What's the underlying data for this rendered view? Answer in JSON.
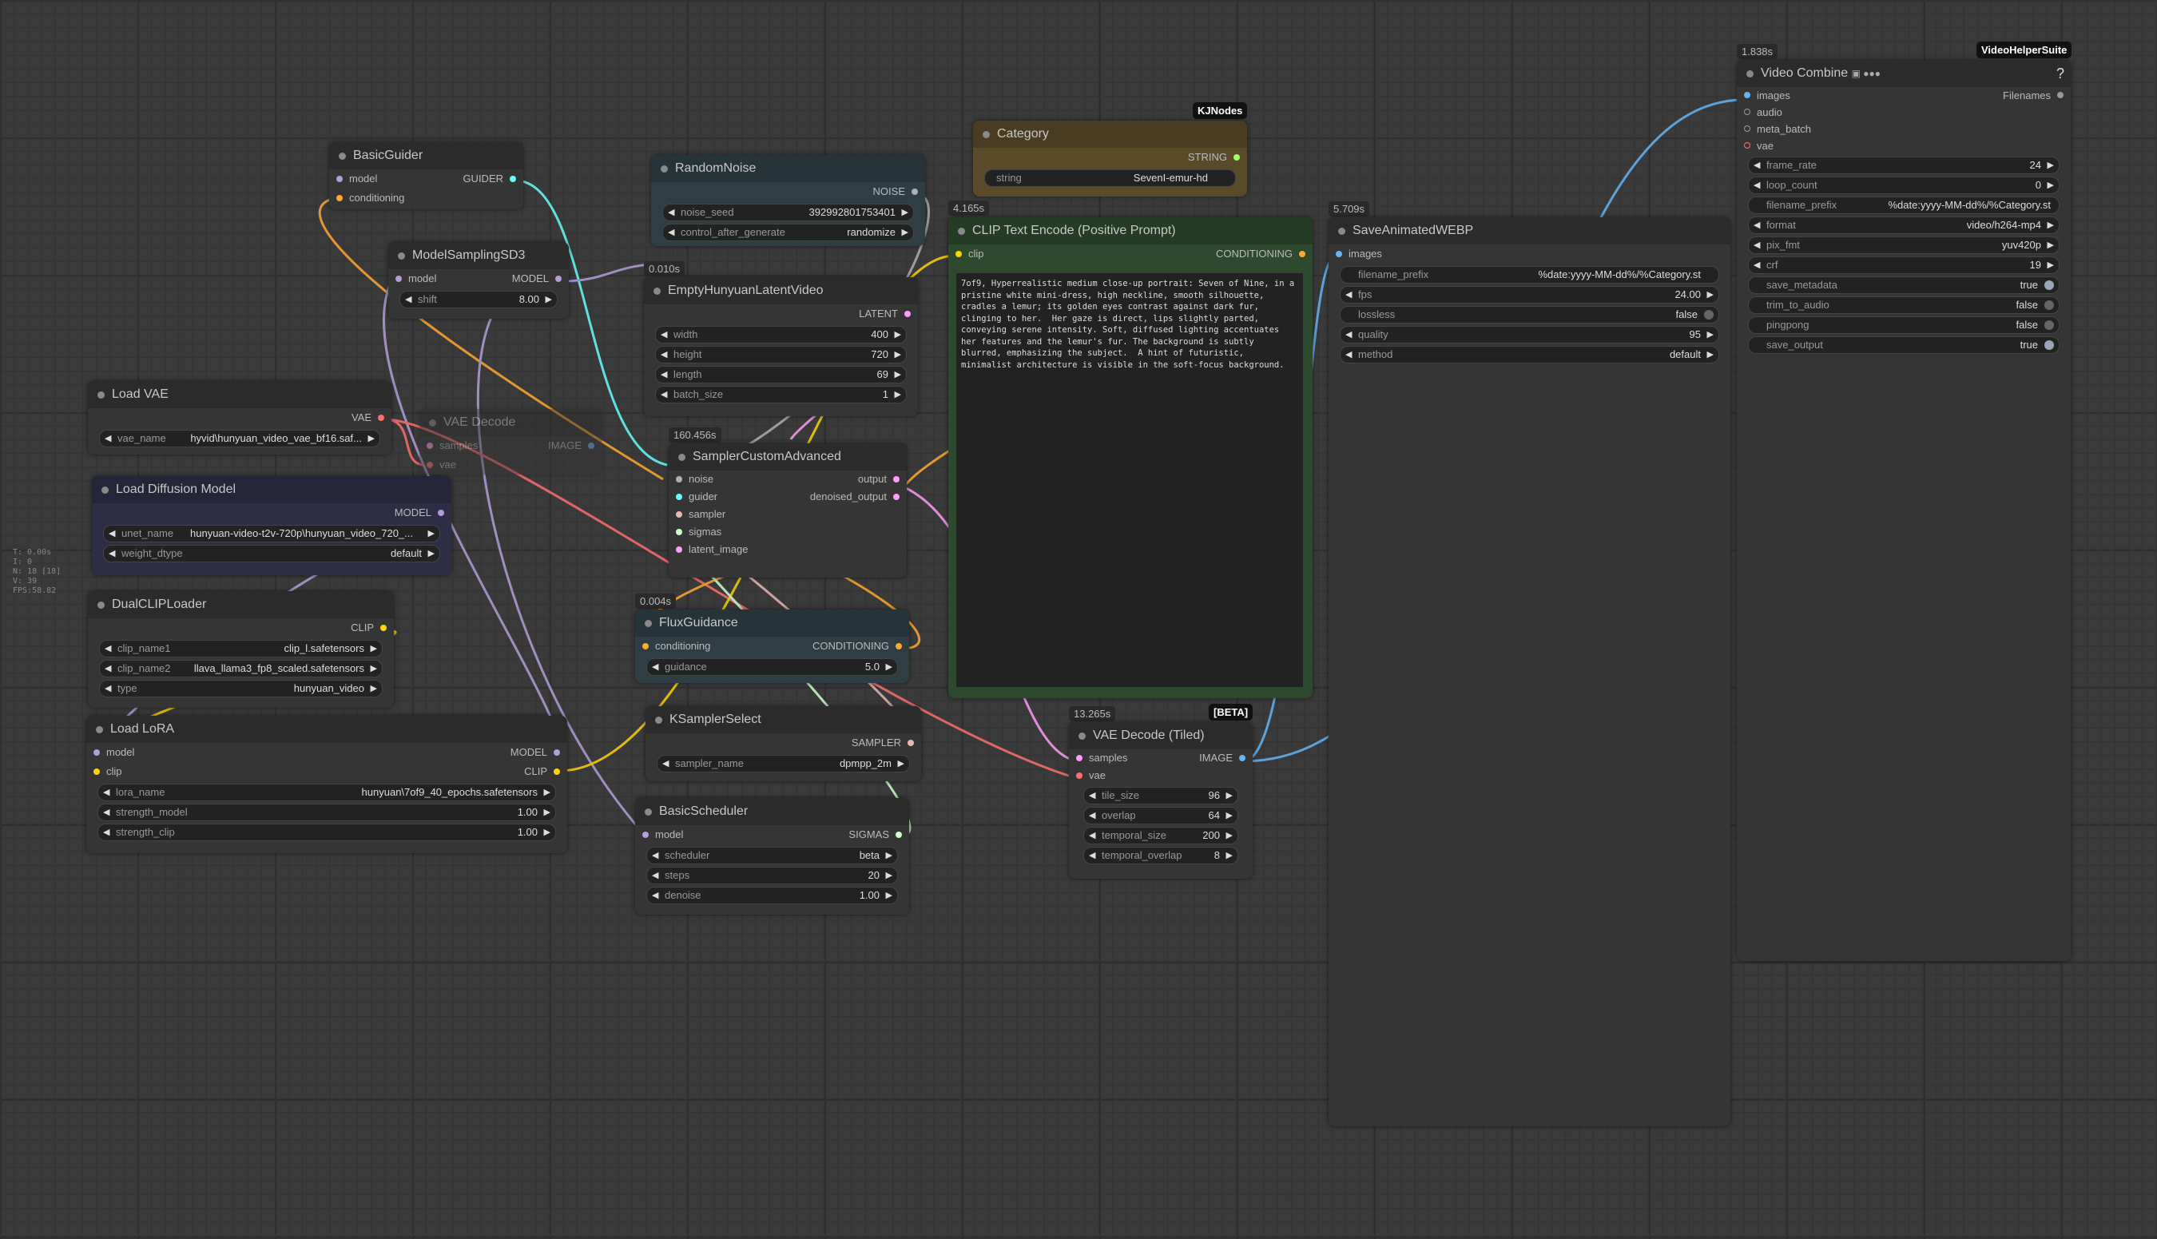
{
  "stats": {
    "t": "T: 0.00s",
    "i": "I: 0",
    "n": "N: 18 [18]",
    "v": "V: 39",
    "fps": "FPS:58.82"
  },
  "nodes": {
    "basic_guider": {
      "title": "BasicGuider",
      "in_model": "model",
      "in_conditioning": "conditioning",
      "out": "GUIDER"
    },
    "model_sampling": {
      "title": "ModelSamplingSD3",
      "in_model": "model",
      "out": "MODEL",
      "shift_label": "shift",
      "shift": "8.00"
    },
    "load_vae": {
      "title": "Load VAE",
      "out": "VAE",
      "vae_name_label": "vae_name",
      "vae_name": "hyvid\\hunyuan_video_vae_bf16.saf..."
    },
    "vae_decode_bypassed": {
      "title": "VAE Decode",
      "in_samples": "samples",
      "in_vae": "vae",
      "out": "IMAGE"
    },
    "load_diffusion": {
      "title": "Load Diffusion Model",
      "out": "MODEL",
      "unet_label": "unet_name",
      "unet": "hunyuan-video-t2v-720p\\hunyuan_video_720_...",
      "dtype_label": "weight_dtype",
      "dtype": "default"
    },
    "dual_clip": {
      "title": "DualCLIPLoader",
      "out": "CLIP",
      "clip1_label": "clip_name1",
      "clip1": "clip_l.safetensors",
      "clip2_label": "clip_name2",
      "clip2": "llava_llama3_fp8_scaled.safetensors",
      "type_label": "type",
      "type": "hunyuan_video"
    },
    "load_lora": {
      "title": "Load LoRA",
      "in_model": "model",
      "in_clip": "clip",
      "out_model": "MODEL",
      "out_clip": "CLIP",
      "lora_label": "lora_name",
      "lora": "hunyuan\\7of9_40_epochs.safetensors",
      "sm_label": "strength_model",
      "sm": "1.00",
      "sc_label": "strength_clip",
      "sc": "1.00"
    },
    "random_noise": {
      "title": "RandomNoise",
      "out": "NOISE",
      "seed_label": "noise_seed",
      "seed": "392992801753401",
      "cag_label": "control_after_generate",
      "cag": "randomize"
    },
    "empty_latent": {
      "time": "0.010s",
      "title": "EmptyHunyuanLatentVideo",
      "out": "LATENT",
      "width_label": "width",
      "width": "400",
      "height_label": "height",
      "height": "720",
      "length_label": "length",
      "length": "69",
      "batch_label": "batch_size",
      "batch": "1"
    },
    "sampler_adv": {
      "time": "160.456s",
      "title": "SamplerCustomAdvanced",
      "in_noise": "noise",
      "in_guider": "guider",
      "in_sampler": "sampler",
      "in_sigmas": "sigmas",
      "in_latent": "latent_image",
      "out_output": "output",
      "out_denoised": "denoised_output"
    },
    "flux_guidance": {
      "time": "0.004s",
      "title": "FluxGuidance",
      "in": "conditioning",
      "out": "CONDITIONING",
      "g_label": "guidance",
      "g": "5.0"
    },
    "ksampler_select": {
      "title": "KSamplerSelect",
      "out": "SAMPLER",
      "sn_label": "sampler_name",
      "sn": "dpmpp_2m"
    },
    "basic_scheduler": {
      "title": "BasicScheduler",
      "in_model": "model",
      "out": "SIGMAS",
      "sch_label": "scheduler",
      "sch": "beta",
      "steps_label": "steps",
      "steps": "20",
      "denoise_label": "denoise",
      "denoise": "1.00"
    },
    "category": {
      "badge": "KJNodes",
      "title": "Category",
      "out": "STRING",
      "s_label": "string",
      "s": "SevenI-emur-hd"
    },
    "clip_text": {
      "time": "4.165s",
      "title": "CLIP Text Encode (Positive Prompt)",
      "in": "clip",
      "out": "CONDITIONING",
      "text": "7of9, Hyperrealistic medium close-up portrait: Seven of Nine, in a pristine white mini-dress, high neckline, smooth silhouette, cradles a lemur; its golden eyes contrast against dark fur, clinging to her.  Her gaze is direct, lips slightly parted, conveying serene intensity. Soft, diffused lighting accentuates her features and the lemur's fur. The background is subtly blurred, emphasizing the subject.  A hint of futuristic, minimalist architecture is visible in the soft-focus background."
    },
    "vae_tiled": {
      "time": "13.265s",
      "badge": "[BETA]",
      "title": "VAE Decode (Tiled)",
      "in_samples": "samples",
      "in_vae": "vae",
      "out": "IMAGE",
      "tile_label": "tile_size",
      "tile": "96",
      "overlap_label": "overlap",
      "overlap": "64",
      "ts_label": "temporal_size",
      "ts": "200",
      "to_label": "temporal_overlap",
      "to": "8"
    },
    "save_webp": {
      "time": "5.709s",
      "title": "SaveAnimatedWEBP",
      "in": "images",
      "fp_label": "filename_prefix",
      "fp": "%date:yyyy-MM-dd%/%Category.st",
      "fps_label": "fps",
      "fps": "24.00",
      "lossless_label": "lossless",
      "lossless": "false",
      "quality_label": "quality",
      "quality": "95",
      "method_label": "method",
      "method": "default"
    },
    "video_combine": {
      "time": "1.838s",
      "badge": "VideoHelperSuite",
      "title": "Video Combine",
      "help": "?",
      "in_images": "images",
      "in_audio": "audio",
      "in_meta": "meta_batch",
      "in_vae": "vae",
      "out": "Filenames",
      "fr_label": "frame_rate",
      "fr": "24",
      "lc_label": "loop_count",
      "lc": "0",
      "fp_label": "filename_prefix",
      "fp": "%date:yyyy-MM-dd%/%Category.st",
      "fmt_label": "format",
      "fmt": "video/h264-mp4",
      "pix_label": "pix_fmt",
      "pix": "yuv420p",
      "crf_label": "crf",
      "crf": "19",
      "sm_label": "save_metadata",
      "sm": "true",
      "tta_label": "trim_to_audio",
      "tta": "false",
      "pp_label": "pingpong",
      "pp": "false",
      "so_label": "save_output",
      "so": "true"
    }
  },
  "colors": {
    "model": "#b39ddb",
    "clip": "#ffd500",
    "vae": "#ff6e6e",
    "conditioning": "#ffa931",
    "latent": "#ff9cf9",
    "image": "#64b5f6",
    "noise": "#b0b0b0",
    "guider": "#66ffff",
    "sampler": "#ecb4b4",
    "sigmas": "#cdffcd"
  }
}
